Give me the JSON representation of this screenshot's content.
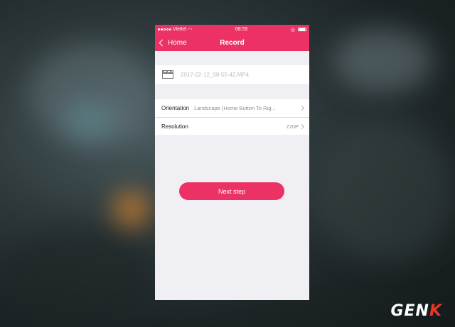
{
  "status_bar": {
    "carrier": "Viettel",
    "time": "08:55"
  },
  "nav": {
    "back_label": "Home",
    "title": "Record"
  },
  "file": {
    "icon": "clapperboard-icon",
    "name": "2017-02-12_08-55-42.MP4"
  },
  "settings": [
    {
      "label": "Orientation",
      "value": "Landscape (Home Button To Rig..."
    },
    {
      "label": "Resolution",
      "value": "720P"
    }
  ],
  "next_button": "Next step",
  "watermark": {
    "part1": "GEN",
    "part2": "K"
  },
  "colors": {
    "accent": "#ec3165",
    "background": "#efeff4"
  }
}
